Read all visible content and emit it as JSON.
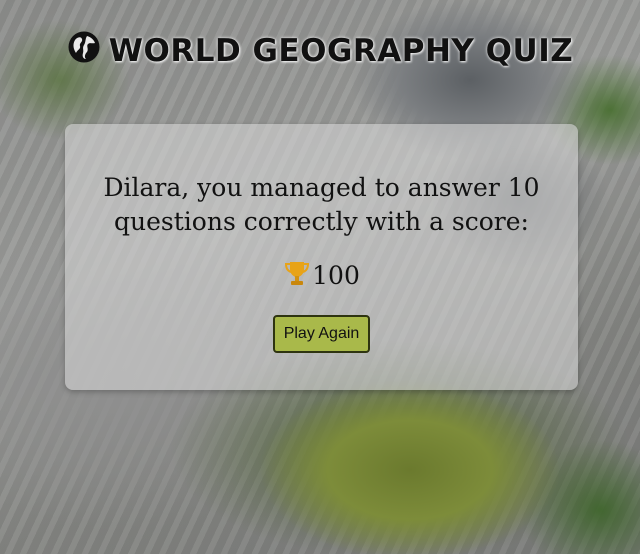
{
  "header": {
    "title": "WORLD GEOGRAPHY QUIZ",
    "icon": "globe-icon"
  },
  "result": {
    "message": "Dilara, you managed to answer 10 questions correctly with a score:",
    "score_icon": "trophy-icon",
    "score": "100",
    "play_again_label": "Play Again"
  },
  "colors": {
    "button_bg": "#a9b94a",
    "trophy": "#e8a317"
  }
}
